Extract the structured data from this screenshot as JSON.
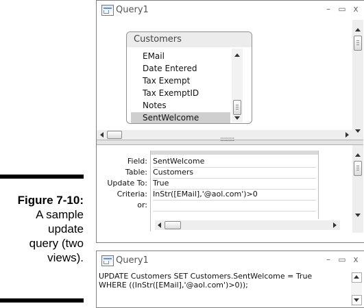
{
  "caption": {
    "figure_label": "Figure 7-10:",
    "lines": [
      "A sample",
      "update",
      "query (two",
      "views)."
    ]
  },
  "design_window": {
    "title": "Query1",
    "buttons": {
      "minimize": "–",
      "maximize": "▭",
      "close": "x"
    },
    "table": {
      "name": "Customers",
      "fields": [
        "EMail",
        "Date Entered",
        "Tax Exempt",
        "Tax ExemptID",
        "Notes",
        "SentWelcome"
      ],
      "selected_field": "SentWelcome"
    },
    "splitter": "::::::::::",
    "grid": {
      "row_labels": [
        "Field:",
        "Table:",
        "Update To:",
        "Criteria:",
        "or:"
      ],
      "column": [
        "SentWelcome",
        "Customers",
        "True",
        "InStr([EMail],'@aol.com')>0",
        ""
      ]
    }
  },
  "sql_window": {
    "title": "Query1",
    "buttons": {
      "minimize": "–",
      "maximize": "▭",
      "close": "x"
    },
    "sql_lines": [
      "UPDATE Customers SET Customers.SentWelcome = True",
      "WHERE ((InStr([EMail],'@aol.com')>0));"
    ]
  },
  "colors": {
    "window_border": "#7f7f7f",
    "selection": "#cfcfcf",
    "scrollbar": "#eeeeee"
  }
}
